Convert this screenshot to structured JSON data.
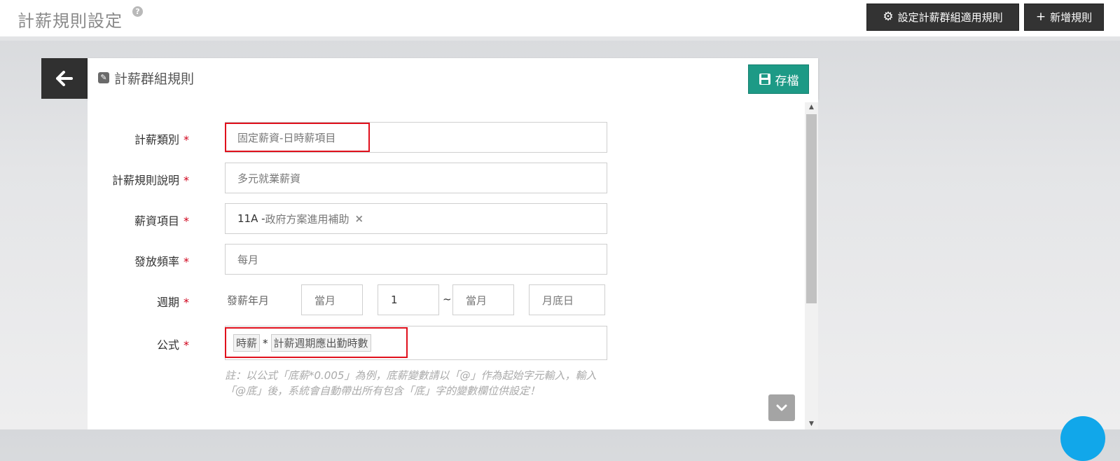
{
  "header": {
    "title": "計薪規則設定",
    "help_icon_label": "?",
    "group_rules_button": "設定計薪群組適用規則",
    "add_rule_button": "新增規則"
  },
  "panel": {
    "title": "計薪群組規則",
    "save_button": "存檔"
  },
  "form": {
    "pay_category": {
      "label": "計薪類別",
      "value": "固定薪資-日時薪項目"
    },
    "rule_description": {
      "label": "計薪規則說明",
      "value": "多元就業薪資"
    },
    "salary_item": {
      "label": "薪資項目",
      "code": "11A - ",
      "name": "政府方案進用補助",
      "remove": "×"
    },
    "frequency": {
      "label": "發放頻率",
      "value": "每月"
    },
    "period": {
      "label": "週期",
      "prefix": "發薪年月",
      "start_month": "當月",
      "start_day": "1",
      "separator": "~",
      "end_month": "當月",
      "end_day": "月底日"
    },
    "formula": {
      "label": "公式",
      "var1": "時薪",
      "operator": "*",
      "var2": "計薪週期應出勤時數"
    },
    "required_mark": "*",
    "note": "註：以公式「底薪*0.005」為例，底薪變數請以「@」作為起始字元輸入，輸入「@底」後，系統會自動帶出所有包含「底」字的變數欄位供設定！"
  },
  "colors": {
    "accent_save": "#1d9a86",
    "dark_button": "#333333",
    "required": "#d0021b",
    "highlight": "#e0101c",
    "fab": "#11a7ea"
  }
}
